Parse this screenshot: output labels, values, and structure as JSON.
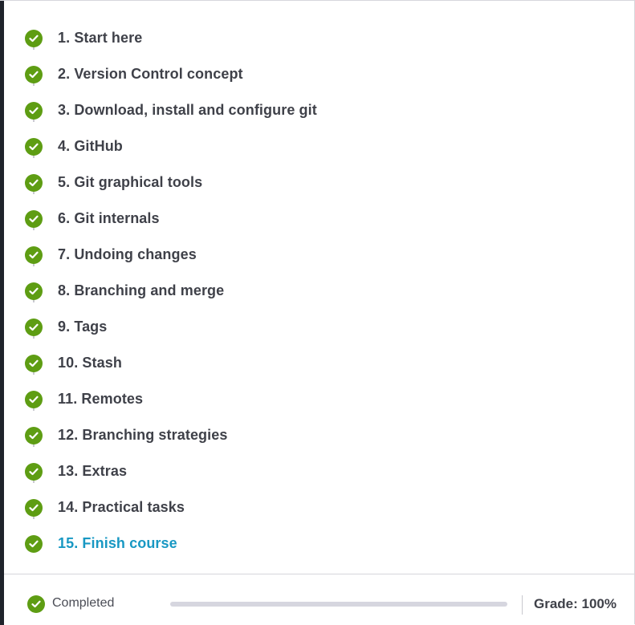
{
  "lessons": [
    {
      "label": "1. Start here",
      "completed": true
    },
    {
      "label": "2. Version Control concept",
      "completed": true
    },
    {
      "label": "3. Download, install and configure git",
      "completed": true
    },
    {
      "label": "4. GitHub",
      "completed": true
    },
    {
      "label": "5. Git graphical tools",
      "completed": true
    },
    {
      "label": "6. Git internals",
      "completed": true
    },
    {
      "label": "7. Undoing changes",
      "completed": true
    },
    {
      "label": "8. Branching and merge",
      "completed": true
    },
    {
      "label": "9. Tags",
      "completed": true
    },
    {
      "label": "10. Stash",
      "completed": true
    },
    {
      "label": "11. Remotes",
      "completed": true
    },
    {
      "label": "12. Branching strategies",
      "completed": true
    },
    {
      "label": "13. Extras",
      "completed": true
    },
    {
      "label": "14. Practical tasks",
      "completed": true
    },
    {
      "label": "15. Finish course",
      "completed": true,
      "active": true
    }
  ],
  "footer": {
    "status_label": "Completed",
    "progress_percent": 100,
    "grade": "Grade: 100%"
  },
  "colors": {
    "check": "#5e9d13",
    "active_link": "#1898c3",
    "text": "#3f4149",
    "track": "#c9c9cf",
    "progress": "#d6d6df"
  },
  "icons": {
    "lesson_status": "check-circle-icon"
  }
}
